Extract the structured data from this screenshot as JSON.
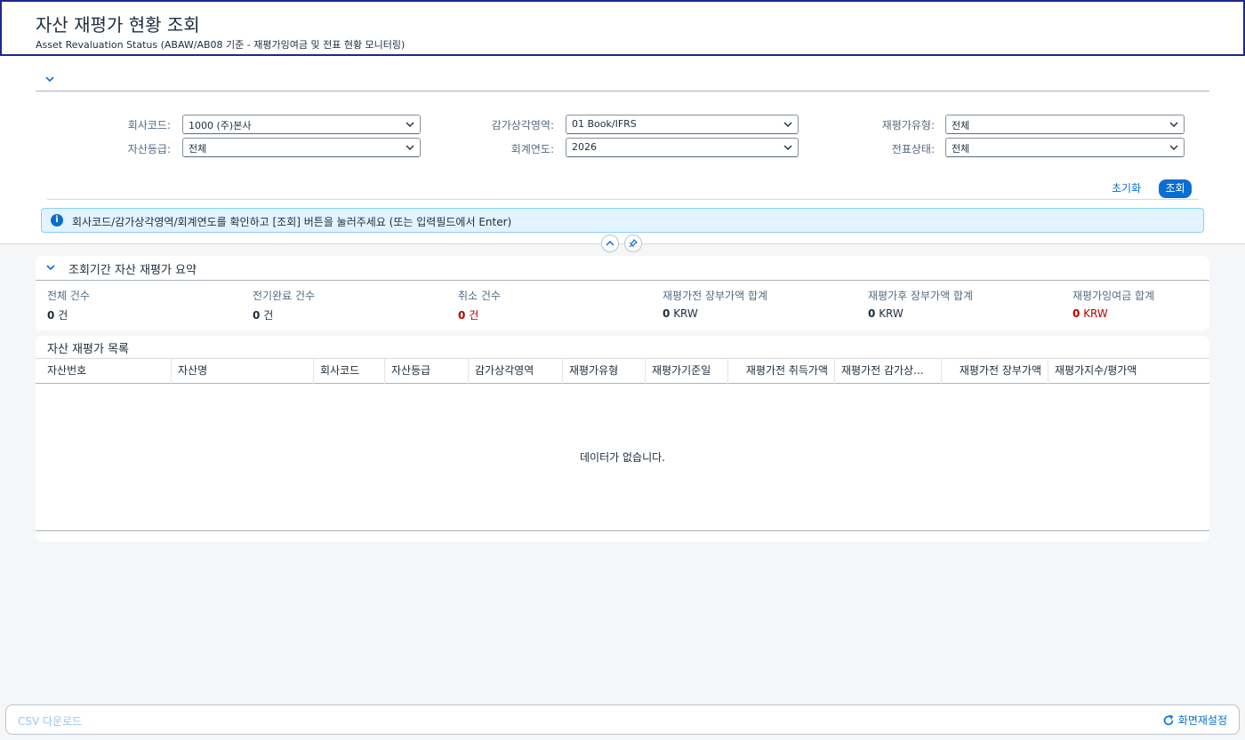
{
  "header": {
    "title": "자산 재평가 현황 조회",
    "subtitle": "Asset Revaluation Status (ABAW/AB08 기준 - 재평가잉여금 및 전표 현황 모니터링)"
  },
  "filters": {
    "company_code": {
      "label": "회사코드:",
      "value": "1000 (주)본사"
    },
    "depreciation_area": {
      "label": "감가상각영역:",
      "value": "01 Book/IFRS"
    },
    "revaluation_type": {
      "label": "재평가유형:",
      "value": "전체"
    },
    "asset_class": {
      "label": "자산등급:",
      "value": "전체"
    },
    "fiscal_year": {
      "label": "회계연도:",
      "value": "2026"
    },
    "doc_status": {
      "label": "전표상태:",
      "value": "전체"
    }
  },
  "toolbar": {
    "reset_label": "초기화",
    "search_label": "조회"
  },
  "message": {
    "text": "회사코드/감가상각영역/회계연도를 확인하고 [조회] 버튼을 눌러주세요 (또는 입력필드에서 Enter)",
    "icon": "info-icon"
  },
  "summary": {
    "title": "조회기간 자산 재평가 요약",
    "kpis": [
      {
        "label": "전체 건수",
        "value": "0",
        "unit": "건"
      },
      {
        "label": "전기완료 건수",
        "value": "0",
        "unit": "건"
      },
      {
        "label": "취소 건수",
        "value": "0",
        "unit": "건"
      },
      {
        "label": "재평가전 장부가액 합계",
        "value": "0",
        "unit": "KRW"
      },
      {
        "label": "재평가후 장부가액 합계",
        "value": "0",
        "unit": "KRW"
      },
      {
        "label": "재평가잉여금 합계",
        "value": "0",
        "unit": "KRW"
      }
    ]
  },
  "table": {
    "title": "자산 재평가 목록",
    "columns": [
      "자산번호",
      "자산명",
      "회사코드",
      "자산등급",
      "감가상각영역",
      "재평가유형",
      "재평가기준일",
      "재평가전 취득가액",
      "재평가전 감가상...",
      "재평가전 장부가액",
      "재평가지수/평가액"
    ],
    "empty_text": "데이터가 없습니다."
  },
  "footer": {
    "csv_label": "CSV 다운로드",
    "refresh_label": "화면재설정"
  },
  "colors": {
    "accent": "#0a6ed1",
    "negative": "#bb0000",
    "header_border": "#1b2a8a",
    "info_bg": "#e1f4ff"
  }
}
